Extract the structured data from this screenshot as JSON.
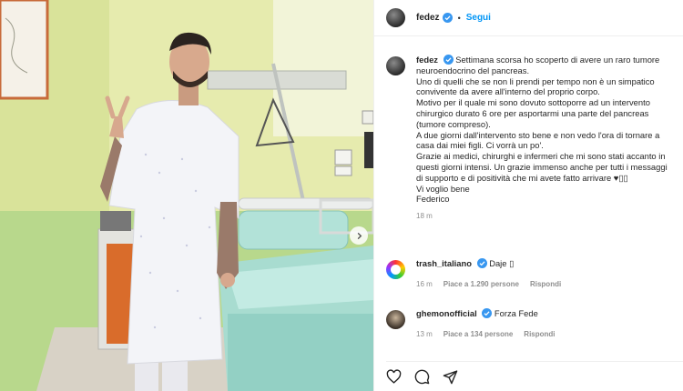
{
  "post": {
    "author": "fedez",
    "follow_label": "Segui",
    "separator": "•"
  },
  "caption": {
    "username": "fedez",
    "text": "Settimana scorsa ho scoperto di avere un raro tumore\nneuroendocrino del pancreas.\nUno di quelli che se non li prendi per tempo non è un simpatico\nconvivente da avere all'interno del proprio corpo.\nMotivo per il quale mi sono dovuto sottoporre ad un intervento\nchirurgico durato 6 ore per asportarmi una parte del pancreas\n(tumore compreso).\nA due giorni dall'intervento sto bene e non vedo l'ora di tornare a\ncasa dai miei figli. Ci vorrà un po'.\nGrazie ai medici, chirurghi e infermeri che mi sono stati accanto in\nquesti giorni intensi. Un grazie immenso anche per tutti i messaggi\ndi supporto e di positività che mi avete fatto arrivare ♥▯▯\nVi voglio bene\nFederico",
    "time": "18 m"
  },
  "comments": [
    {
      "username": "trash_italiano",
      "text": "Daje ▯",
      "time": "16 m",
      "likes": "Piace a 1.290 persone",
      "reply": "Rispondi"
    },
    {
      "username": "ghemonofficial",
      "text": "Forza Fede",
      "time": "13 m",
      "likes": "Piace a 134 persone",
      "reply": "Rispondi"
    }
  ],
  "icons": {
    "verified": "verified-badge-icon",
    "like": "heart-icon",
    "comment": "comment-icon",
    "share": "share-icon",
    "next": "chevron-right-icon"
  },
  "colors": {
    "link": "#0095f6",
    "verified": "#3897f0",
    "muted": "#8e8e8e",
    "wall": "#e7ecb0",
    "sheet": "#a8dcd0"
  }
}
